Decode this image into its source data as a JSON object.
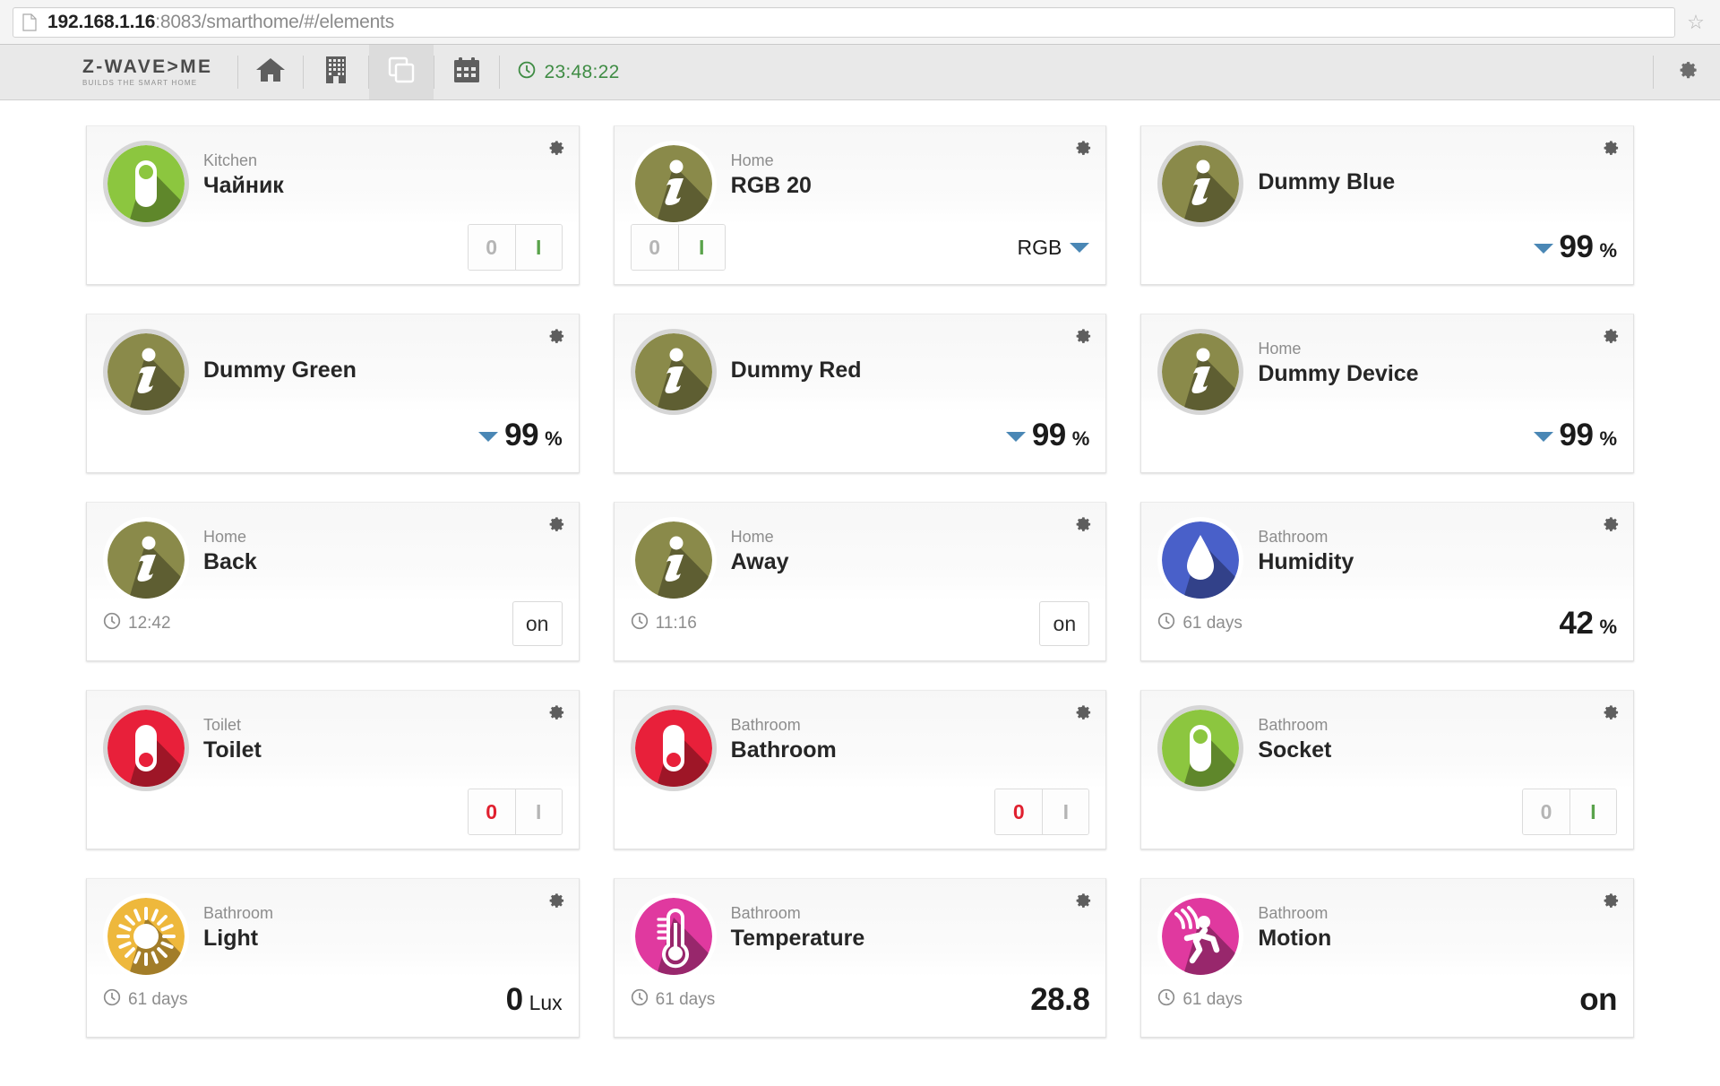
{
  "browser": {
    "url_host": "192.168.1.16",
    "url_path": ":8083/smarthome/#/elements",
    "page_icon": "page-icon",
    "bookmark_icon": "star-icon"
  },
  "topnav": {
    "logo_main": "Z-WAVE>ME",
    "logo_sub": "BUILDS THE SMART HOME",
    "items": [
      {
        "name": "home",
        "icon": "home-icon",
        "active": false
      },
      {
        "name": "rooms",
        "icon": "building-icon",
        "active": false
      },
      {
        "name": "elements",
        "icon": "elements-icon",
        "active": true
      },
      {
        "name": "events",
        "icon": "calendar-icon",
        "active": false
      }
    ],
    "clock": "23:48:22",
    "clock_icon": "clock-icon",
    "settings_icon": "gear-icon",
    "clock_color": "#3f8c44"
  },
  "cards": [
    {
      "room": "Kitchen",
      "name": "Чайник",
      "icon": "socket-icon",
      "icon_color": "#8cc63f",
      "icon_ring": true,
      "control": "toggle",
      "toggle_off": "0",
      "toggle_on": "I",
      "toggle_state": "on"
    },
    {
      "room": "Home",
      "name": "RGB 20",
      "icon": "info-icon",
      "icon_color": "#8a8a4a",
      "icon_ring": false,
      "control": "toggle-rgb",
      "toggle_off": "0",
      "toggle_on": "I",
      "toggle_state": "on",
      "rgb_label": "RGB",
      "rgb_swatch": "#4a87b5"
    },
    {
      "room": "",
      "name": "Dummy Blue",
      "icon": "info-icon",
      "icon_color": "#8a8a4a",
      "icon_ring": true,
      "control": "level",
      "level_value": "99",
      "level_unit": "%",
      "level_arrow_color": "#4a87b5"
    },
    {
      "room": "",
      "name": "Dummy Green",
      "icon": "info-icon",
      "icon_color": "#8a8a4a",
      "icon_ring": true,
      "control": "level",
      "level_value": "99",
      "level_unit": "%",
      "level_arrow_color": "#4a87b5"
    },
    {
      "room": "",
      "name": "Dummy Red",
      "icon": "info-icon",
      "icon_color": "#8a8a4a",
      "icon_ring": true,
      "control": "level",
      "level_value": "99",
      "level_unit": "%",
      "level_arrow_color": "#4a87b5"
    },
    {
      "room": "Home",
      "name": "Dummy Device",
      "icon": "info-icon",
      "icon_color": "#8a8a4a",
      "icon_ring": true,
      "control": "level",
      "level_value": "99",
      "level_unit": "%",
      "level_arrow_color": "#4a87b5"
    },
    {
      "room": "Home",
      "name": "Back",
      "icon": "info-icon",
      "icon_color": "#8a8a4a",
      "icon_ring": false,
      "control": "onbox",
      "stamp": "12:42",
      "stamp_icon": "clock-icon",
      "onbox_label": "on"
    },
    {
      "room": "Home",
      "name": "Away",
      "icon": "info-icon",
      "icon_color": "#8a8a4a",
      "icon_ring": false,
      "control": "onbox",
      "stamp": "11:16",
      "stamp_icon": "clock-icon",
      "onbox_label": "on"
    },
    {
      "room": "Bathroom",
      "name": "Humidity",
      "icon": "droplet-icon",
      "icon_color": "#4960c9",
      "icon_ring": false,
      "control": "readout",
      "stamp": "61 days",
      "stamp_icon": "clock-icon",
      "level_value": "42",
      "level_unit": "%"
    },
    {
      "room": "Toilet",
      "name": "Toilet",
      "icon": "socket-off-icon",
      "icon_color": "#e8203a",
      "icon_ring": true,
      "control": "toggle",
      "toggle_off": "0",
      "toggle_on": "I",
      "toggle_state": "off"
    },
    {
      "room": "Bathroom",
      "name": "Bathroom",
      "icon": "socket-off-icon",
      "icon_color": "#e8203a",
      "icon_ring": true,
      "control": "toggle",
      "toggle_off": "0",
      "toggle_on": "I",
      "toggle_state": "off"
    },
    {
      "room": "Bathroom",
      "name": "Socket",
      "icon": "socket-icon",
      "icon_color": "#8cc63f",
      "icon_ring": true,
      "control": "toggle",
      "toggle_off": "0",
      "toggle_on": "I",
      "toggle_state": "on"
    },
    {
      "room": "Bathroom",
      "name": "Light",
      "icon": "sun-icon",
      "icon_color": "#eeb83c",
      "icon_ring": false,
      "control": "readout",
      "stamp": "61 days",
      "stamp_icon": "clock-icon",
      "level_value": "0",
      "level_unit": "Lux"
    },
    {
      "room": "Bathroom",
      "name": "Temperature",
      "icon": "thermometer-icon",
      "icon_color": "#e0399f",
      "icon_ring": false,
      "control": "readout",
      "stamp": "61 days",
      "stamp_icon": "clock-icon",
      "level_value": "28.8",
      "level_unit": ""
    },
    {
      "room": "Bathroom",
      "name": "Motion",
      "icon": "motion-icon",
      "icon_color": "#e0399f",
      "icon_ring": false,
      "control": "readout",
      "stamp": "61 days",
      "stamp_icon": "clock-icon",
      "level_value": "on",
      "level_unit": ""
    }
  ]
}
